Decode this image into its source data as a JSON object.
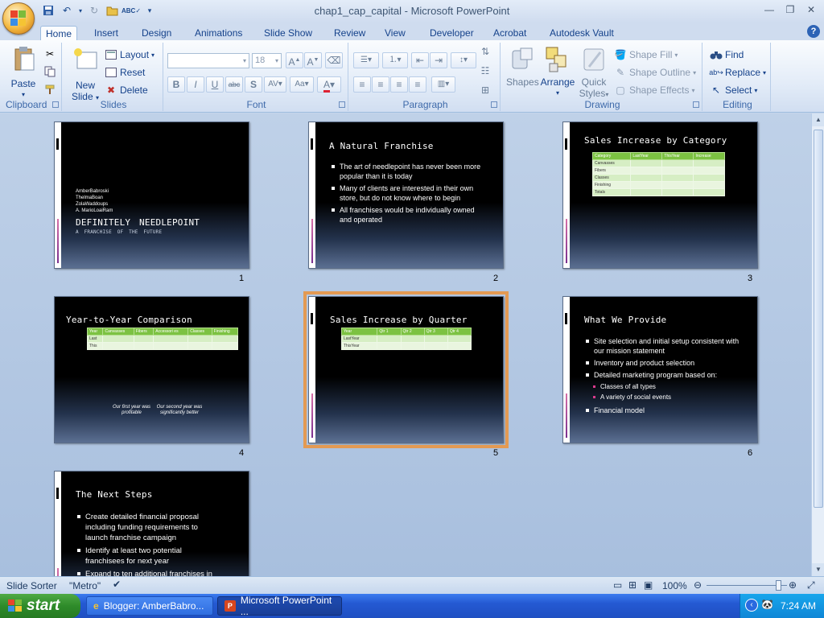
{
  "window": {
    "title": "chap1_cap_capital - Microsoft PowerPoint"
  },
  "tabs": [
    "Home",
    "Insert",
    "Design",
    "Animations",
    "Slide Show",
    "Review",
    "View",
    "Developer",
    "Acrobat",
    "Autodesk Vault"
  ],
  "ribbon": {
    "clipboard": {
      "label": "Clipboard",
      "paste": "Paste"
    },
    "slides": {
      "label": "Slides",
      "new_slide_1": "New",
      "new_slide_2": "Slide",
      "layout": "Layout",
      "reset": "Reset",
      "delete": "Delete"
    },
    "font": {
      "label": "Font",
      "size": "18"
    },
    "paragraph": {
      "label": "Paragraph"
    },
    "drawing": {
      "label": "Drawing",
      "shapes": "Shapes",
      "arrange": "Arrange",
      "quick_styles_1": "Quick",
      "quick_styles_2": "Styles",
      "shape_fill": "Shape Fill",
      "shape_outline": "Shape Outline",
      "shape_effects": "Shape Effects"
    },
    "editing": {
      "label": "Editing",
      "find": "Find",
      "replace": "Replace",
      "select": "Select"
    }
  },
  "slides": [
    {
      "number": "1",
      "authors": [
        "AmberBabroski",
        "ThelmaBoan",
        "ZolaWaddoups",
        "A. MarioLoaiRam"
      ],
      "title": "DEFINITELY NEEDLEPOINT",
      "subtitle": "A FRANCHISE OF THE FUTURE"
    },
    {
      "number": "2",
      "title": "A Natural Franchise",
      "bullets": [
        "The art of needlepoint has never been more popular than it is today",
        "Many of clients are interested in their own store, but do not know where to begin",
        "All franchises would be individually owned and operated"
      ]
    },
    {
      "number": "3",
      "title": "Sales Increase by Category",
      "table_headers": [
        "Category",
        "LastYear",
        "ThisYear",
        "Increase"
      ],
      "table_rows": [
        "Canvasses",
        "Fibers",
        "Classes",
        "Finishing",
        "Totals"
      ]
    },
    {
      "number": "4",
      "title": "Year-to-Year Comparison",
      "table_headers": [
        "Year",
        "Canvasses",
        "Fibers",
        "Accessori es",
        "Classes",
        "Finishing"
      ],
      "table_rows": [
        "Last",
        "This"
      ],
      "note_left": "Our first year was profitable",
      "note_right": "Our second year was significantly better"
    },
    {
      "number": "5",
      "title": "Sales Increase by Quarter",
      "table_headers": [
        "Year",
        "Qtr 1",
        "Qtr 2",
        "Qtr 3",
        "Qtr 4"
      ],
      "table_rows": [
        "LastYear",
        "ThisYear"
      ]
    },
    {
      "number": "6",
      "title": "What We Provide",
      "bullets": [
        "Site selection and initial setup consistent with our mission statement",
        "Inventory and product selection",
        "Detailed marketing program based on:"
      ],
      "sub_bullets": [
        "Classes of all types",
        "A variety of social events"
      ],
      "last_bullet": "Financial model"
    },
    {
      "number": "7",
      "title": "The Next Steps",
      "bullets": [
        "Create detailed financial proposal including funding requirements to launch franchise campaign",
        "Identify at least two potential franchisees for next year",
        "Expand to ten additional franchises in"
      ]
    }
  ],
  "status": {
    "view": "Slide Sorter",
    "theme": "\"Metro\"",
    "zoom": "100%"
  },
  "taskbar": {
    "start": "start",
    "items": [
      "Blogger: AmberBabro...",
      "Microsoft PowerPoint ..."
    ],
    "time": "7:24 AM"
  }
}
